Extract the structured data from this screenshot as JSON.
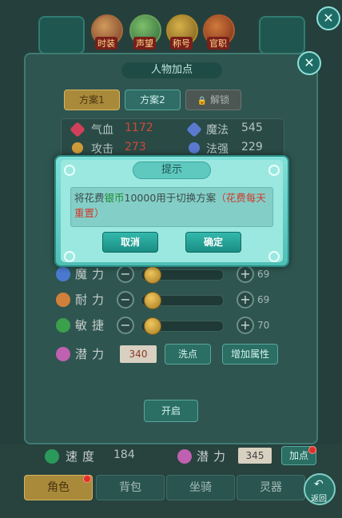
{
  "top_tabs": {
    "icons": [
      {
        "label": "时装",
        "icon": "costume-icon"
      },
      {
        "label": "声望",
        "icon": "reputation-icon"
      },
      {
        "label": "称号",
        "icon": "title-icon"
      },
      {
        "label": "官职",
        "icon": "office-icon"
      }
    ]
  },
  "panel": {
    "title": "人物加点",
    "schemes": [
      "方案1",
      "方案2",
      "解锁"
    ],
    "stats": {
      "hp_label": "气血",
      "hp_value": "1172",
      "mp_label": "魔法",
      "mp_value": "545",
      "atk_label": "攻击",
      "atk_value": "273",
      "matk_label": "法强",
      "matk_value": "229"
    },
    "attributes": [
      {
        "label": "魔力",
        "value": "69",
        "level": 0.15
      },
      {
        "label": "耐力",
        "value": "69",
        "level": 0.15
      },
      {
        "label": "敏捷",
        "value": "70",
        "level": 0.15
      }
    ],
    "potential_label": "潜力",
    "potential_value": "340",
    "wash_button": "洗点",
    "add_attr_button": "增加属性",
    "open_button": "开启"
  },
  "footer_stats": {
    "speed_label": "速度",
    "speed_value": "184",
    "potential_label": "潜力",
    "potential_value": "345",
    "add_point_button": "加点"
  },
  "bottom_tabs": [
    "角色",
    "背包",
    "坐骑",
    "灵器"
  ],
  "back_button": "返回",
  "dialog": {
    "title": "提示",
    "msg_part1": "将花费",
    "msg_currency": "银币",
    "msg_part2": "10000用于切换方案",
    "msg_note": "（花费每天重置）",
    "cancel": "取消",
    "confirm": "确定"
  },
  "colors": {
    "accent": "#2fa89d",
    "warning_text": "#d03a2a",
    "currency_text": "#1f8a2a"
  }
}
